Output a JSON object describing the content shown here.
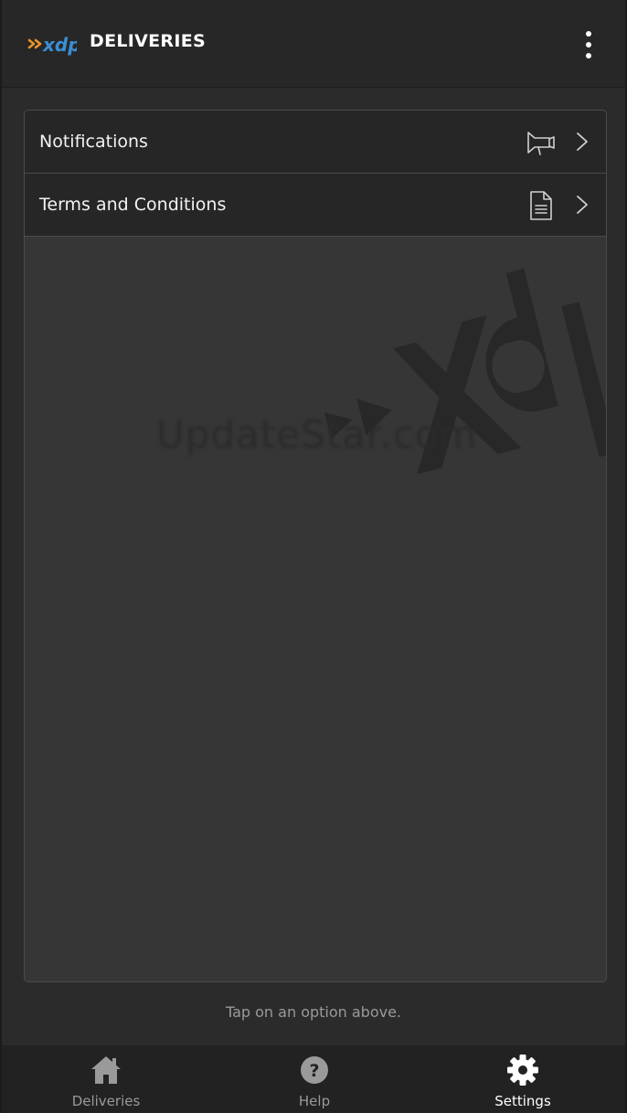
{
  "header": {
    "logo_text": "xdp",
    "title": "DELIVERIES",
    "menu_icon": "more-vertical-icon"
  },
  "settings": {
    "options": [
      {
        "label": "Notifications",
        "icon": "megaphone-icon"
      },
      {
        "label": "Terms and Conditions",
        "icon": "document-icon"
      }
    ],
    "watermark": "UpdateStar.com",
    "hint": "Tap on an option above."
  },
  "tabbar": {
    "tabs": [
      {
        "label": "Deliveries",
        "icon": "home-icon",
        "active": false
      },
      {
        "label": "Help",
        "icon": "help-icon",
        "active": false
      },
      {
        "label": "Settings",
        "icon": "gear-icon",
        "active": true
      }
    ]
  },
  "colors": {
    "background": "#2b2b2b",
    "header": "#272727",
    "row": "#262626",
    "panel": "#363636",
    "logo_orange": "#e8952a",
    "logo_blue": "#3a8fd6",
    "active_tab": "#ffffff",
    "inactive_tab": "#9a9a9a"
  }
}
